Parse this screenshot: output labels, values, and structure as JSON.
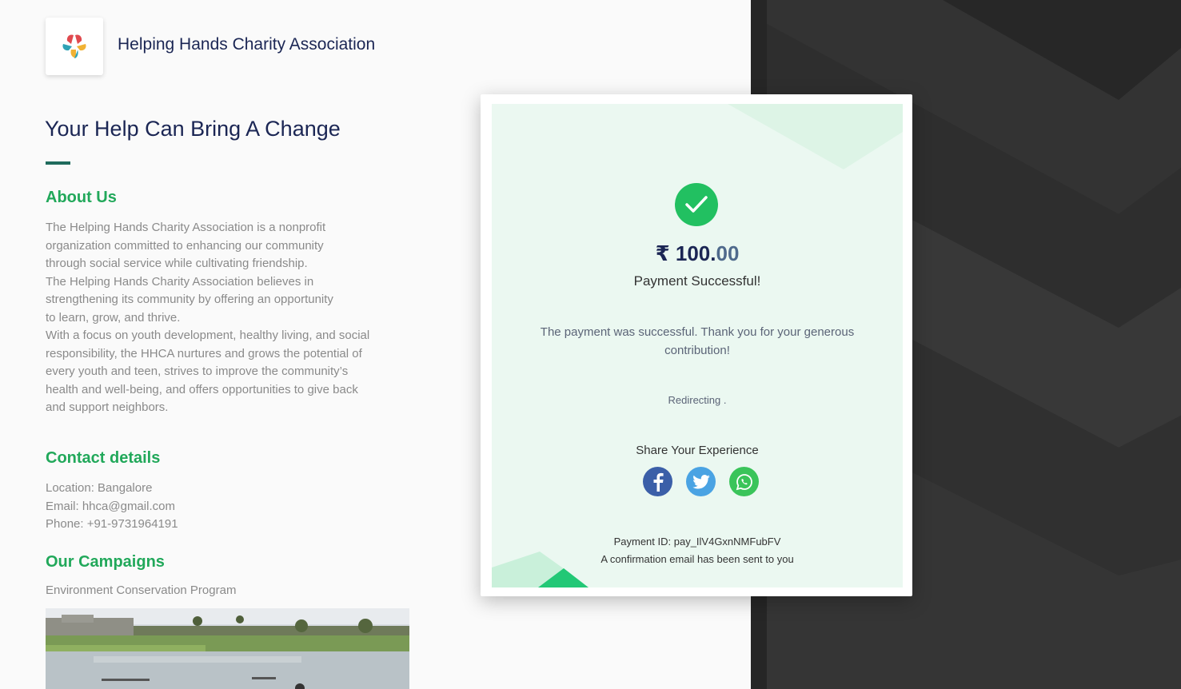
{
  "org": {
    "name": "Helping Hands Charity Association",
    "logo_icon": "helping-hands-logo-icon"
  },
  "headline": "Your Help Can Bring A Change",
  "about": {
    "heading": "About Us",
    "lines": [
      "The Helping Hands Charity Association is a nonprofit",
      "organization committed to enhancing our community",
      "through social service while cultivating friendship.",
      "The Helping Hands Charity Association believes in",
      "strengthening its community by offering an opportunity",
      "to learn, grow, and thrive.",
      "With a focus on youth development, healthy living, and social",
      "responsibility, the HHCA nurtures and grows the potential of",
      "every youth and teen, strives to improve the community’s",
      "health and well-being, and offers opportunities to give back",
      "and support neighbors."
    ]
  },
  "contact": {
    "heading": "Contact details",
    "location": "Location: Bangalore",
    "email": "Email: hhca@gmail.com",
    "phone": "Phone: +91-9731964191"
  },
  "campaigns": {
    "heading": "Our Campaigns",
    "items": [
      "Environment Conservation Program"
    ]
  },
  "payment": {
    "currency": "₹",
    "amount_int": "100.",
    "amount_dec": "00",
    "status": "Payment Successful!",
    "message": "The payment was successful. Thank you for your generous contribution!",
    "redirecting": "Redirecting .",
    "share_title": "Share Your Experience",
    "share_icons": [
      "facebook-icon",
      "twitter-icon",
      "whatsapp-icon"
    ],
    "payment_id": "Payment ID: pay_IlV4GxnNMFubFV",
    "confirmation": "A confirmation email has been sent to you"
  },
  "colors": {
    "navy": "#1b2654",
    "green": "#21a85a",
    "success": "#22c061",
    "dark_bg": "#2a2a2a",
    "card_bg": "#ebf8f1"
  }
}
